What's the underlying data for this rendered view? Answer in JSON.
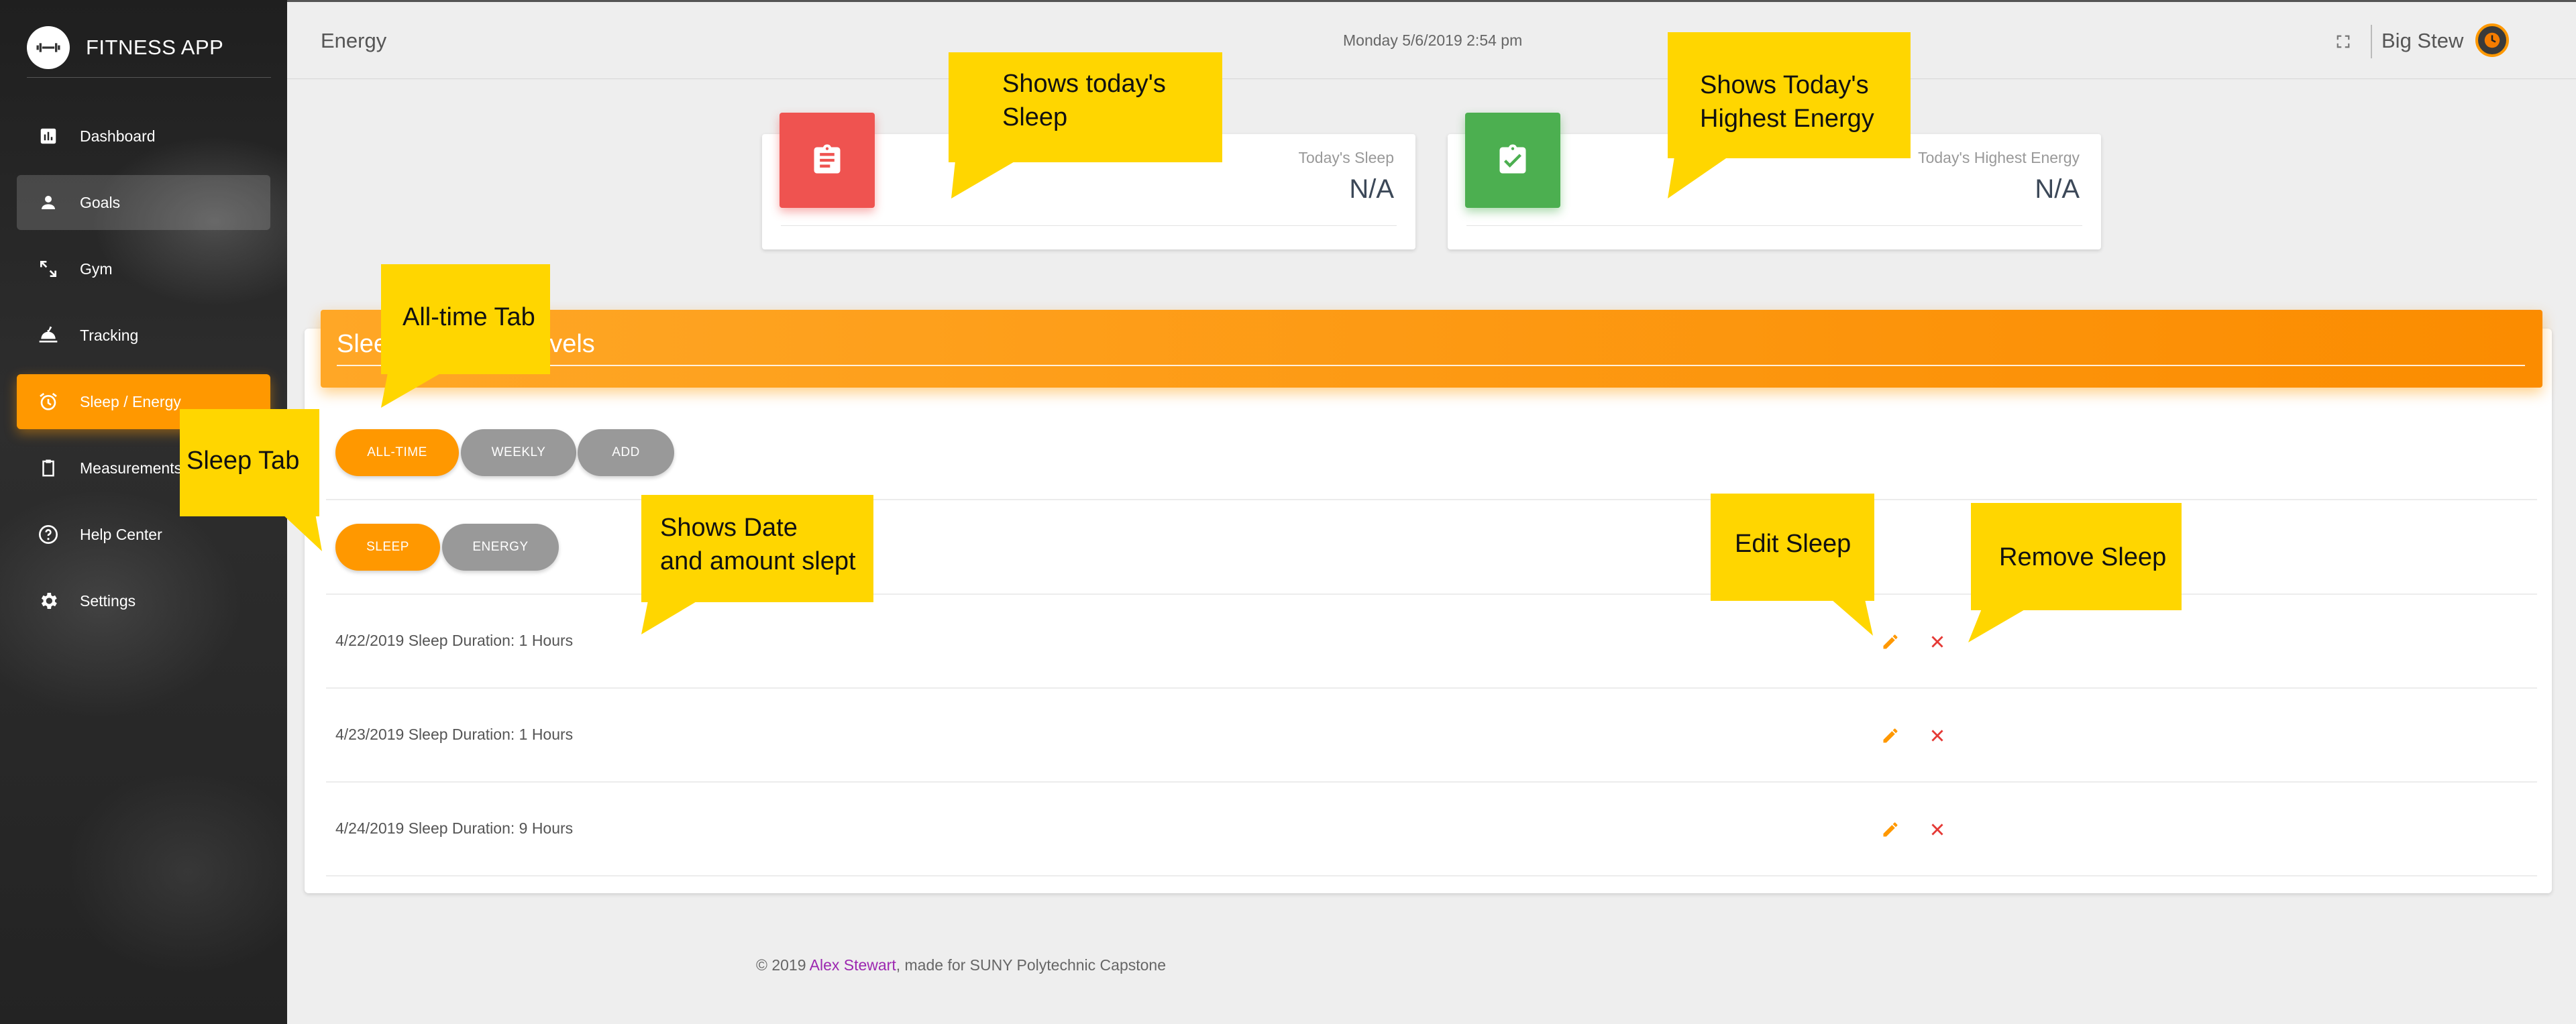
{
  "app": {
    "title": "FITNESS APP"
  },
  "sidebar": {
    "items": [
      {
        "label": "Dashboard",
        "icon": "bar-chart-icon"
      },
      {
        "label": "Goals",
        "icon": "person-icon"
      },
      {
        "label": "Gym",
        "icon": "expand-arrows-icon"
      },
      {
        "label": "Tracking",
        "icon": "food-tray-icon"
      },
      {
        "label": "Sleep / Energy",
        "icon": "alarm-clock-icon"
      },
      {
        "label": "Measurements",
        "icon": "clipboard-icon"
      },
      {
        "label": "Help Center",
        "icon": "help-circle-icon"
      },
      {
        "label": "Settings",
        "icon": "gear-icon"
      }
    ]
  },
  "header": {
    "page_title": "Energy",
    "datetime": "Monday 5/6/2019 2:54 pm",
    "username": "Big Stew"
  },
  "stats": {
    "sleep": {
      "label": "Today's Sleep",
      "value": "N/A",
      "color": "#ef5350"
    },
    "energy": {
      "label": "Today's Highest Energy",
      "value": "N/A",
      "color": "#4caf50"
    }
  },
  "main": {
    "title_visible_start": "Slee",
    "title_visible_end": "evels",
    "range_tabs": [
      "ALL-TIME",
      "WEEKLY",
      "ADD"
    ],
    "type_tabs": [
      "SLEEP",
      "ENERGY"
    ],
    "rows": [
      {
        "text": "4/22/2019 Sleep Duration: 1 Hours"
      },
      {
        "text": "4/23/2019 Sleep Duration: 1 Hours"
      },
      {
        "text": "4/24/2019 Sleep Duration: 9 Hours"
      }
    ]
  },
  "footer": {
    "prefix": "© 2019 ",
    "author": "Alex Stewart",
    "suffix": ", made for SUNY Polytechnic Capstone"
  },
  "annotations": {
    "todays_sleep": [
      "Shows today's",
      "Sleep"
    ],
    "todays_energy": [
      "Shows Today's",
      "Highest Energy"
    ],
    "all_time_tab": [
      "All-time Tab"
    ],
    "sleep_tab": [
      "Sleep Tab"
    ],
    "date_amount": [
      "Shows Date",
      "and amount slept"
    ],
    "edit_sleep": [
      "Edit Sleep"
    ],
    "remove_sleep": [
      "Remove Sleep"
    ]
  },
  "colors": {
    "accent": "#ff9800",
    "callout": "#ffd600",
    "remove": "#e53935",
    "link": "#9c27b0"
  }
}
